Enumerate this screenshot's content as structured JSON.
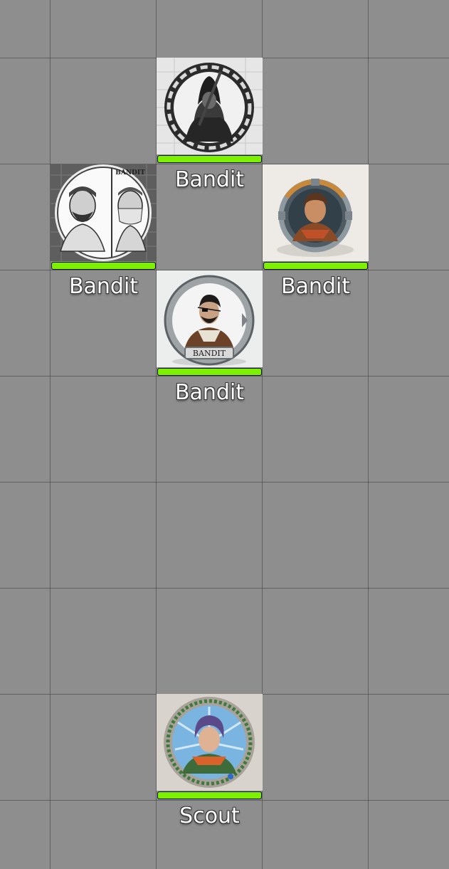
{
  "colors": {
    "grid_background": "#8e8e8e",
    "grid_lines": "#5a5a5a",
    "hp_bar": "#7df000",
    "nameplate_text": "#ffffff"
  },
  "tokens": [
    {
      "name": "Bandit",
      "portrait": "hooded-rogue-grayscale-icon",
      "hp_fraction": 1.0
    },
    {
      "name": "Bandit",
      "portrait": "masked-bandit-duo-sketch-icon",
      "badge_text": "BANDIT",
      "hp_fraction": 1.0
    },
    {
      "name": "Bandit",
      "portrait": "young-rogue-color-coin-icon",
      "hp_fraction": 1.0
    },
    {
      "name": "Bandit",
      "portrait": "eyepatch-bandit-coin-icon",
      "badge_text": "BANDIT",
      "hp_fraction": 1.0
    },
    {
      "name": "Scout",
      "portrait": "scout-rainbow-coin-icon",
      "hp_fraction": 1.0
    }
  ]
}
